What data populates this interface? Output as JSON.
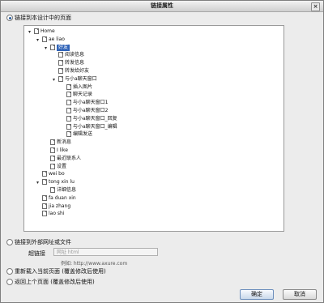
{
  "dialog": {
    "title": "链接属性",
    "close": "×"
  },
  "options": [
    {
      "label": "链接到本设计中的页面",
      "checked": true
    },
    {
      "label": "链接到外部网址或文件",
      "checked": false
    },
    {
      "label": "重新载入当前页面 (覆盖修改后使用)",
      "checked": false
    },
    {
      "label": "返回上个页面 (覆盖修改后使用)",
      "checked": false
    }
  ],
  "tree": [
    {
      "label": "Home",
      "toggle": "▾",
      "level": 0
    },
    {
      "label": "ae liao",
      "toggle": "▾",
      "level": 1
    },
    {
      "label": "好友",
      "toggle": "▾",
      "level": 2,
      "selected": true
    },
    {
      "label": "阅读信息",
      "level": 3
    },
    {
      "label": "转发信息",
      "level": 3
    },
    {
      "label": "转发给好友",
      "level": 3
    },
    {
      "label": "与小a聊天窗口",
      "toggle": "▾",
      "level": 3
    },
    {
      "label": "插入图片",
      "level": 4
    },
    {
      "label": "聊天记录",
      "level": 4
    },
    {
      "label": "与小a聊天窗口1",
      "level": 4
    },
    {
      "label": "与小a聊天窗口2",
      "level": 4
    },
    {
      "label": "与小a聊天窗口_回复",
      "level": 4
    },
    {
      "label": "与小a聊天窗口_编辑",
      "level": 4
    },
    {
      "label": "编辑发送",
      "level": 4
    },
    {
      "label": "新消息",
      "level": 2
    },
    {
      "label": "I like",
      "level": 2
    },
    {
      "label": "最近联系人",
      "level": 2
    },
    {
      "label": "设置",
      "level": 2
    },
    {
      "label": "wei bo",
      "level": 1
    },
    {
      "label": "tong xin lu",
      "toggle": "▾",
      "level": 1
    },
    {
      "label": "详细信息",
      "level": 2
    },
    {
      "label": "fa duan xin",
      "level": 1
    },
    {
      "label": "jia zhang",
      "level": 1
    },
    {
      "label": "lao shi",
      "level": 1
    }
  ],
  "external": {
    "field_label": "超链接",
    "placeholder": "网址 html",
    "example": "例如: http://www.axure.com"
  },
  "buttons": {
    "ok": "确定",
    "cancel": "取消"
  }
}
